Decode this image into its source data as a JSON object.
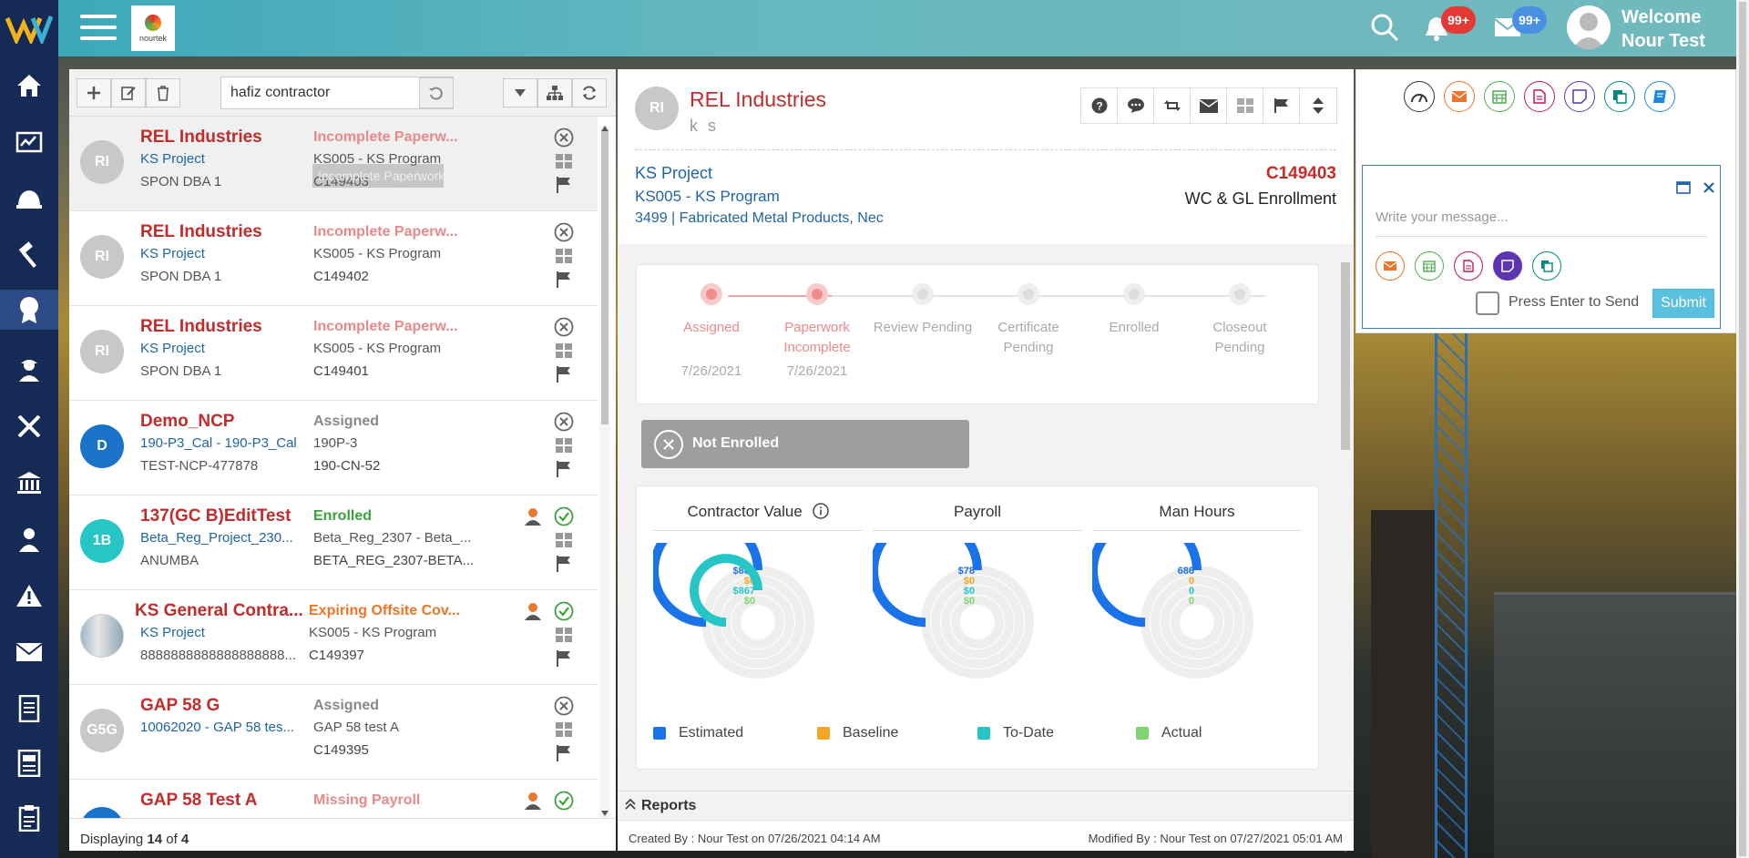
{
  "topbar": {
    "brand": "nourtek",
    "notif_count": "99+",
    "mail_count": "99+",
    "welcome": "Welcome",
    "user": "Nour Test"
  },
  "list_toolbar": {
    "search_value": "hafiz contractor"
  },
  "rows": [
    {
      "initials": "RI",
      "name": "REL Industries",
      "project": "KS Project",
      "sub": "SPON DBA 1",
      "status": "Incomplete Paperw...",
      "program": "KS005 - KS Program",
      "code": "C149403"
    },
    {
      "initials": "RI",
      "name": "REL Industries",
      "project": "KS Project",
      "sub": "SPON DBA 1",
      "status": "Incomplete Paperw...",
      "program": "KS005 - KS Program",
      "code": "C149402"
    },
    {
      "initials": "RI",
      "name": "REL Industries",
      "project": "KS Project",
      "sub": "SPON DBA 1",
      "status": "Incomplete Paperw...",
      "program": "KS005 - KS Program",
      "code": "C149401"
    },
    {
      "initials": "D",
      "name": "Demo_NCP",
      "project": "190-P3_Cal - 190-P3_Cal",
      "sub": "TEST-NCP-477878",
      "status": "Assigned",
      "program": "190P-3",
      "code": "190-CN-52"
    },
    {
      "initials": "1B",
      "name": "137(GC B)EditTest",
      "project": "Beta_Reg_Project_230...",
      "sub": "ANUMBA",
      "status": "Enrolled",
      "program": "Beta_Reg_2307 - Beta_...",
      "code": "BETA_REG_2307-BETA..."
    },
    {
      "initials": "",
      "name": "KS General Contra...",
      "project": "KS Project",
      "sub": "8888888888888888888...",
      "status": "Expiring Offsite Cov...",
      "program": "KS005 - KS Program",
      "code": "C149397"
    },
    {
      "initials": "G5G",
      "name": "GAP 58 G",
      "project": "10062020 - GAP 58 tes...",
      "sub": "",
      "status": "Assigned",
      "program": "GAP 58 test A",
      "code": "C149395"
    },
    {
      "initials": "",
      "name": "GAP 58 Test A",
      "project": "",
      "sub": "",
      "status": "Missing Payroll",
      "program": "",
      "code": ""
    }
  ],
  "tooltip": "Incomplete Paperwork",
  "list_footer": {
    "prefix": "Displaying",
    "shown": "14",
    "of": "of",
    "total": "4"
  },
  "detail": {
    "initials": "RI",
    "title": "REL Industries",
    "subtitle": "k s",
    "project": "KS Project",
    "program": "KS005 - KS Program",
    "sic": "3499 | Fabricated Metal Products, Nec",
    "contract_no": "C149403",
    "enrollment": "WC & GL Enrollment",
    "steps": [
      {
        "label": "Assigned",
        "date": "7/26/2021"
      },
      {
        "label": "Paperwork Incomplete",
        "date": "7/26/2021"
      },
      {
        "label": "Review Pending",
        "date": ""
      },
      {
        "label": "Certificate Pending",
        "date": ""
      },
      {
        "label": "Enrolled",
        "date": ""
      },
      {
        "label": "Closeout Pending",
        "date": ""
      }
    ],
    "status_banner": "Not Enrolled",
    "reports": "Reports",
    "created": "Created By : Nour Test on 07/26/2021 04:14 AM",
    "modified": "Modified By : Nour Test on 07/27/2021 05:01 AM"
  },
  "chart_data": [
    {
      "type": "radial-bar",
      "title": "Contractor Value",
      "series": [
        {
          "name": "Estimated",
          "label": "$867",
          "value": 867
        },
        {
          "name": "Baseline",
          "label": "$0",
          "value": 0
        },
        {
          "name": "To-Date",
          "label": "$867",
          "value": 867
        },
        {
          "name": "Actual",
          "label": "$0",
          "value": 0
        }
      ]
    },
    {
      "type": "radial-bar",
      "title": "Payroll",
      "series": [
        {
          "name": "Estimated",
          "label": "$78",
          "value": 78
        },
        {
          "name": "Baseline",
          "label": "$0",
          "value": 0
        },
        {
          "name": "To-Date",
          "label": "$0",
          "value": 0
        },
        {
          "name": "Actual",
          "label": "$0",
          "value": 0
        }
      ]
    },
    {
      "type": "radial-bar",
      "title": "Man Hours",
      "series": [
        {
          "name": "Estimated",
          "label": "686",
          "value": 686
        },
        {
          "name": "Baseline",
          "label": "0",
          "value": 0
        },
        {
          "name": "To-Date",
          "label": "0",
          "value": 0
        },
        {
          "name": "Actual",
          "label": "0",
          "value": 0
        }
      ]
    }
  ],
  "legend": [
    {
      "name": "Estimated",
      "color": "#1a73e8"
    },
    {
      "name": "Baseline",
      "color": "#f5a623"
    },
    {
      "name": "To-Date",
      "color": "#26c6c6"
    },
    {
      "name": "Actual",
      "color": "#7ed56f"
    }
  ],
  "message": {
    "placeholder": "Write your message...",
    "enter_label": "Press Enter to Send",
    "submit": "Submit"
  }
}
